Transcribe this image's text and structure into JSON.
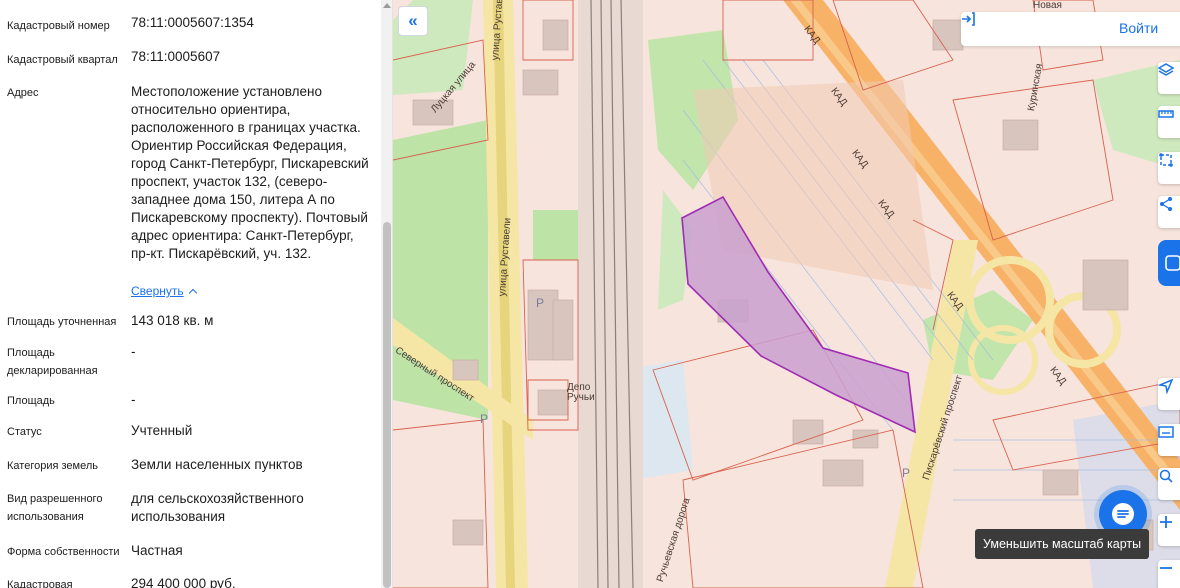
{
  "panel": {
    "fields": [
      {
        "label": "Кадастровый номер",
        "value": "78:11:0005607:1354"
      },
      {
        "label": "Кадастровый квартал",
        "value": "78:11:0005607"
      },
      {
        "label": "Адрес",
        "value": "Местоположение установлено относительно ориентира, расположенного в границах участка. Ориентир Российская Федерация, город Санкт-Петербург, Пискаревский проспект, участок 132, (северо-западнее дома 150, литера А по Пискаревскому проспекту). Почтовый адрес ориентира: Санкт-Петербург, пр-кт. Пискарёвский, уч. 132."
      },
      {
        "label": "Площадь уточненная",
        "value": "143 018 кв. м"
      },
      {
        "label": "Площадь декларированная",
        "value": "-"
      },
      {
        "label": "Площадь",
        "value": "-"
      },
      {
        "label": "Статус",
        "value": "Учтенный"
      },
      {
        "label": "Категория земель",
        "value": "Земли населенных пунктов"
      },
      {
        "label": "Вид разрешенного использования",
        "value": "для сельскохозяйственного использования"
      },
      {
        "label": "Форма собственности",
        "value": "Частная"
      },
      {
        "label": "Кадастровая",
        "value": "294 400 000 руб."
      }
    ],
    "collapse_label": "Свернуть"
  },
  "map": {
    "login_label": "Войти",
    "tooltip": "Уменьшить масштаб карты",
    "labels": {
      "rustaveli_1": "улица Руставели",
      "rustaveli_2": "улица Руставели",
      "severny": "Северный проспект",
      "depo": "Депо",
      "ruchi": "Ручьи",
      "kad_1": "КАД",
      "kad_2": "КАД",
      "kad_3": "КАД",
      "kad_4": "КАД",
      "kad_5": "КАД",
      "kad_6": "КАД",
      "piskarevsky": "Пискарёвский проспект",
      "lutskaya": "Луцкая улица",
      "ruchyevskaya": "Ручьевская дорога",
      "kurinskaya": "Куринская",
      "novaya": "Новая",
      "parking_1": "P",
      "parking_2": "P",
      "parking_3": "P"
    },
    "colors": {
      "accent": "#1a73e8",
      "highlight_fill": "#c9a0cf",
      "highlight_stroke": "#a02bb5",
      "kad_road": "#f7b267",
      "green": "#b8e0a2"
    },
    "controls": [
      "layers-icon",
      "ruler-icon",
      "select-area-icon",
      "share-icon",
      "geolocation-icon",
      "print-icon",
      "search-location-icon",
      "zoom-in-icon"
    ]
  }
}
